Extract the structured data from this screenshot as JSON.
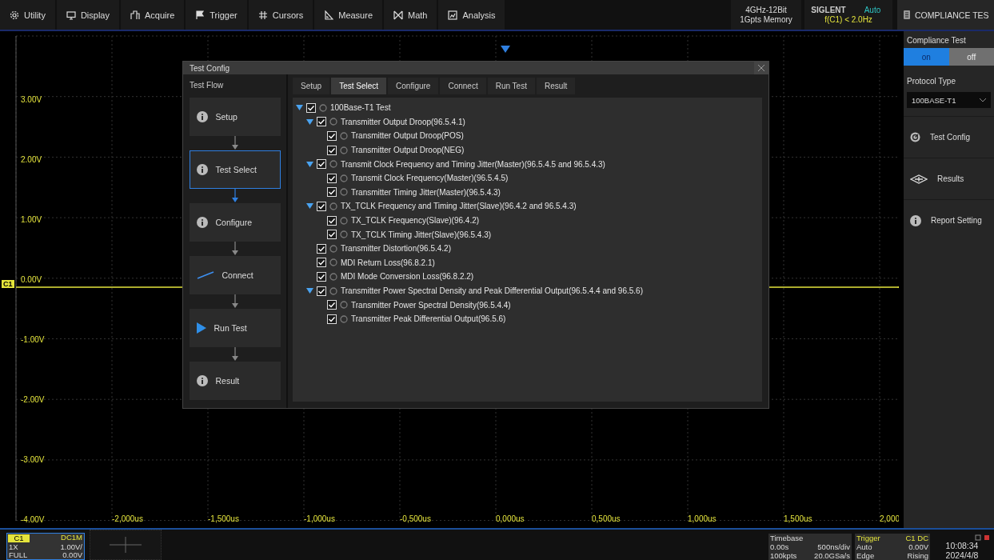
{
  "menu": [
    {
      "label": "Utility"
    },
    {
      "label": "Display"
    },
    {
      "label": "Acquire"
    },
    {
      "label": "Trigger"
    },
    {
      "label": "Cursors"
    },
    {
      "label": "Measure"
    },
    {
      "label": "Math"
    },
    {
      "label": "Analysis"
    }
  ],
  "spec": [
    "4GHz-12Bit",
    "1Gpts Memory"
  ],
  "brand": {
    "name": "SIGLENT",
    "trigger_mode": "Auto",
    "frequency": "f(C1) < 2.0Hz"
  },
  "panel_title": "COMPLIANCE TES",
  "scope": {
    "y_labels": [
      "3.00V",
      "2.00V",
      "1.00V",
      "0.00V",
      "-1.00V",
      "-2.00V",
      "-3.00V",
      "-4.00V"
    ],
    "x_labels": [
      "-2,000us",
      "-1,500us",
      "-1,000us",
      "-0,500us",
      "0,000us",
      "0,500us",
      "1,000us",
      "1,500us",
      "2,000"
    ],
    "channel_marker": "C1"
  },
  "dialog": {
    "title": "Test Config",
    "flow_title": "Test Flow",
    "steps": [
      {
        "label": "Setup",
        "kind": "info",
        "selected": false
      },
      {
        "label": "Test Select",
        "kind": "info",
        "selected": true
      },
      {
        "label": "Configure",
        "kind": "info",
        "selected": false
      },
      {
        "label": "Connect",
        "kind": "line",
        "selected": false
      },
      {
        "label": "Run Test",
        "kind": "play",
        "selected": false
      },
      {
        "label": "Result",
        "kind": "info",
        "selected": false
      }
    ],
    "tabs": [
      {
        "label": "Setup",
        "selected": false
      },
      {
        "label": "Test Select",
        "selected": true
      },
      {
        "label": "Configure",
        "selected": false
      },
      {
        "label": "Connect",
        "selected": false
      },
      {
        "label": "Run Test",
        "selected": false
      },
      {
        "label": "Result",
        "selected": false
      }
    ],
    "tree": [
      {
        "label": "100Base-T1 Test",
        "checked": true,
        "selected": false,
        "expanded": true,
        "children": [
          {
            "label": "Transmitter Output Droop(96.5.4.1)",
            "checked": true,
            "selected": false,
            "expanded": true,
            "children": [
              {
                "label": "Transmitter Output Droop(POS)",
                "checked": true,
                "selected": false
              },
              {
                "label": "Transmitter Output Droop(NEG)",
                "checked": true,
                "selected": false
              }
            ]
          },
          {
            "label": "Transmit Clock Frequency and Timing Jitter(Master)(96.5.4.5 and 96.5.4.3)",
            "checked": true,
            "selected": false,
            "expanded": true,
            "children": [
              {
                "label": "Transmit Clock Frequency(Master)(96.5.4.5)",
                "checked": true,
                "selected": false
              },
              {
                "label": "Transmitter Timing Jitter(Master)(96.5.4.3)",
                "checked": true,
                "selected": false
              }
            ]
          },
          {
            "label": "TX_TCLK Frequency and Timing Jitter(Slave)(96.4.2 and 96.5.4.3)",
            "checked": true,
            "selected": false,
            "expanded": true,
            "children": [
              {
                "label": "TX_TCLK Frequency(Slave)(96.4.2)",
                "checked": true,
                "selected": false
              },
              {
                "label": "TX_TCLK Timing Jitter(Slave)(96.5.4.3)",
                "checked": true,
                "selected": false
              }
            ]
          },
          {
            "label": "Transmitter Distortion(96.5.4.2)",
            "checked": true,
            "selected": false
          },
          {
            "label": "MDI Return Loss(96.8.2.1)",
            "checked": true,
            "selected": false
          },
          {
            "label": "MDI Mode Conversion Loss(96.8.2.2)",
            "checked": true,
            "selected": false
          },
          {
            "label": "Transmitter Power Spectral Density and Peak Differential Output(96.5.4.4 and 96.5.6)",
            "checked": true,
            "selected": false,
            "expanded": true,
            "children": [
              {
                "label": "Transmitter Power Spectral Density(96.5.4.4)",
                "checked": true,
                "selected": false
              },
              {
                "label": "Transmitter Peak Differential Output(96.5.6)",
                "checked": true,
                "selected": false
              }
            ]
          }
        ]
      }
    ]
  },
  "side": {
    "title": "Compliance Test",
    "toggle": [
      {
        "label": "on",
        "selected": true
      },
      {
        "label": "off",
        "selected": false
      }
    ],
    "protocol_label": "Protocol Type",
    "protocol_value": "100BASE-T1",
    "items": [
      {
        "label": "Test Config"
      },
      {
        "label": "Results"
      },
      {
        "label": "Report Setting"
      }
    ]
  },
  "channel": {
    "name": "C1",
    "coupling": "DC1M",
    "probe": "1X",
    "scale": "1.00V/",
    "bandwidth": "FULL",
    "offset": "0.00V"
  },
  "timebase": {
    "title": "Timebase",
    "delay": "0.00s",
    "scale": "500ns/div",
    "depth": "100kpts",
    "rate": "20.0GSa/s"
  },
  "trigger": {
    "title": "Trigger",
    "source": "C1 DC",
    "mode": "Auto",
    "level": "0.00V",
    "type": "Edge",
    "slope": "Rising"
  },
  "clock": {
    "time": "10:08:34",
    "date": "2024/4/8"
  }
}
